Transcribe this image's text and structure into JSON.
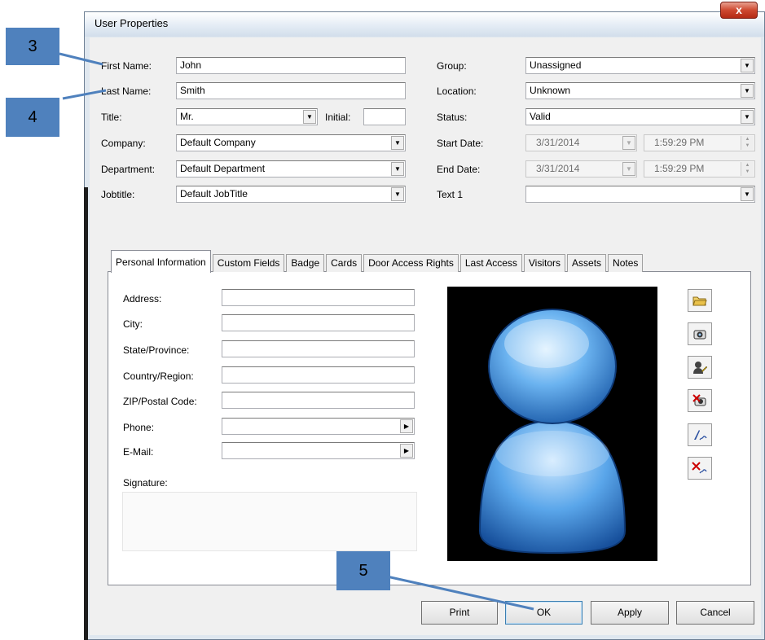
{
  "window": {
    "title": "User Properties",
    "close_glyph": "x"
  },
  "fields": {
    "first_name_label": "First Name:",
    "first_name": "John",
    "last_name_label": "Last Name:",
    "last_name": "Smith",
    "title_label": "Title:",
    "title": "Mr.",
    "initial_label": "Initial:",
    "initial": "",
    "company_label": "Company:",
    "company": "Default Company",
    "department_label": "Department:",
    "department": "Default Department",
    "jobtitle_label": "Jobtitle:",
    "jobtitle": "Default JobTitle",
    "group_label": "Group:",
    "group": "Unassigned",
    "location_label": "Location:",
    "location": "Unknown",
    "status_label": "Status:",
    "status": "Valid",
    "start_date_label": "Start Date:",
    "start_date": "3/31/2014",
    "start_time": "1:59:29 PM",
    "end_date_label": "End Date:",
    "end_date": "3/31/2014",
    "end_time": "1:59:29 PM",
    "text1_label": "Text 1",
    "text1": ""
  },
  "tabs": [
    "Personal Information",
    "Custom Fields",
    "Badge",
    "Cards",
    "Door Access Rights",
    "Last Access",
    "Visitors",
    "Assets",
    "Notes"
  ],
  "personal": {
    "address_label": "Address:",
    "city_label": "City:",
    "state_label": "State/Province:",
    "country_label": "Country/Region:",
    "zip_label": "ZIP/Postal Code:",
    "phone_label": "Phone:",
    "email_label": "E-Mail:",
    "signature_label": "Signature:"
  },
  "photo_tools": [
    "open-folder-icon",
    "camera-icon",
    "edit-photo-icon",
    "delete-photo-icon",
    "signature-icon",
    "delete-signature-icon"
  ],
  "buttons": {
    "print": "Print",
    "ok": "OK",
    "apply": "Apply",
    "cancel": "Cancel"
  },
  "callouts": {
    "c3": "3",
    "c4": "4",
    "c5": "5"
  },
  "colors": {
    "callout": "#4f81bd",
    "close": "#c9452d"
  }
}
